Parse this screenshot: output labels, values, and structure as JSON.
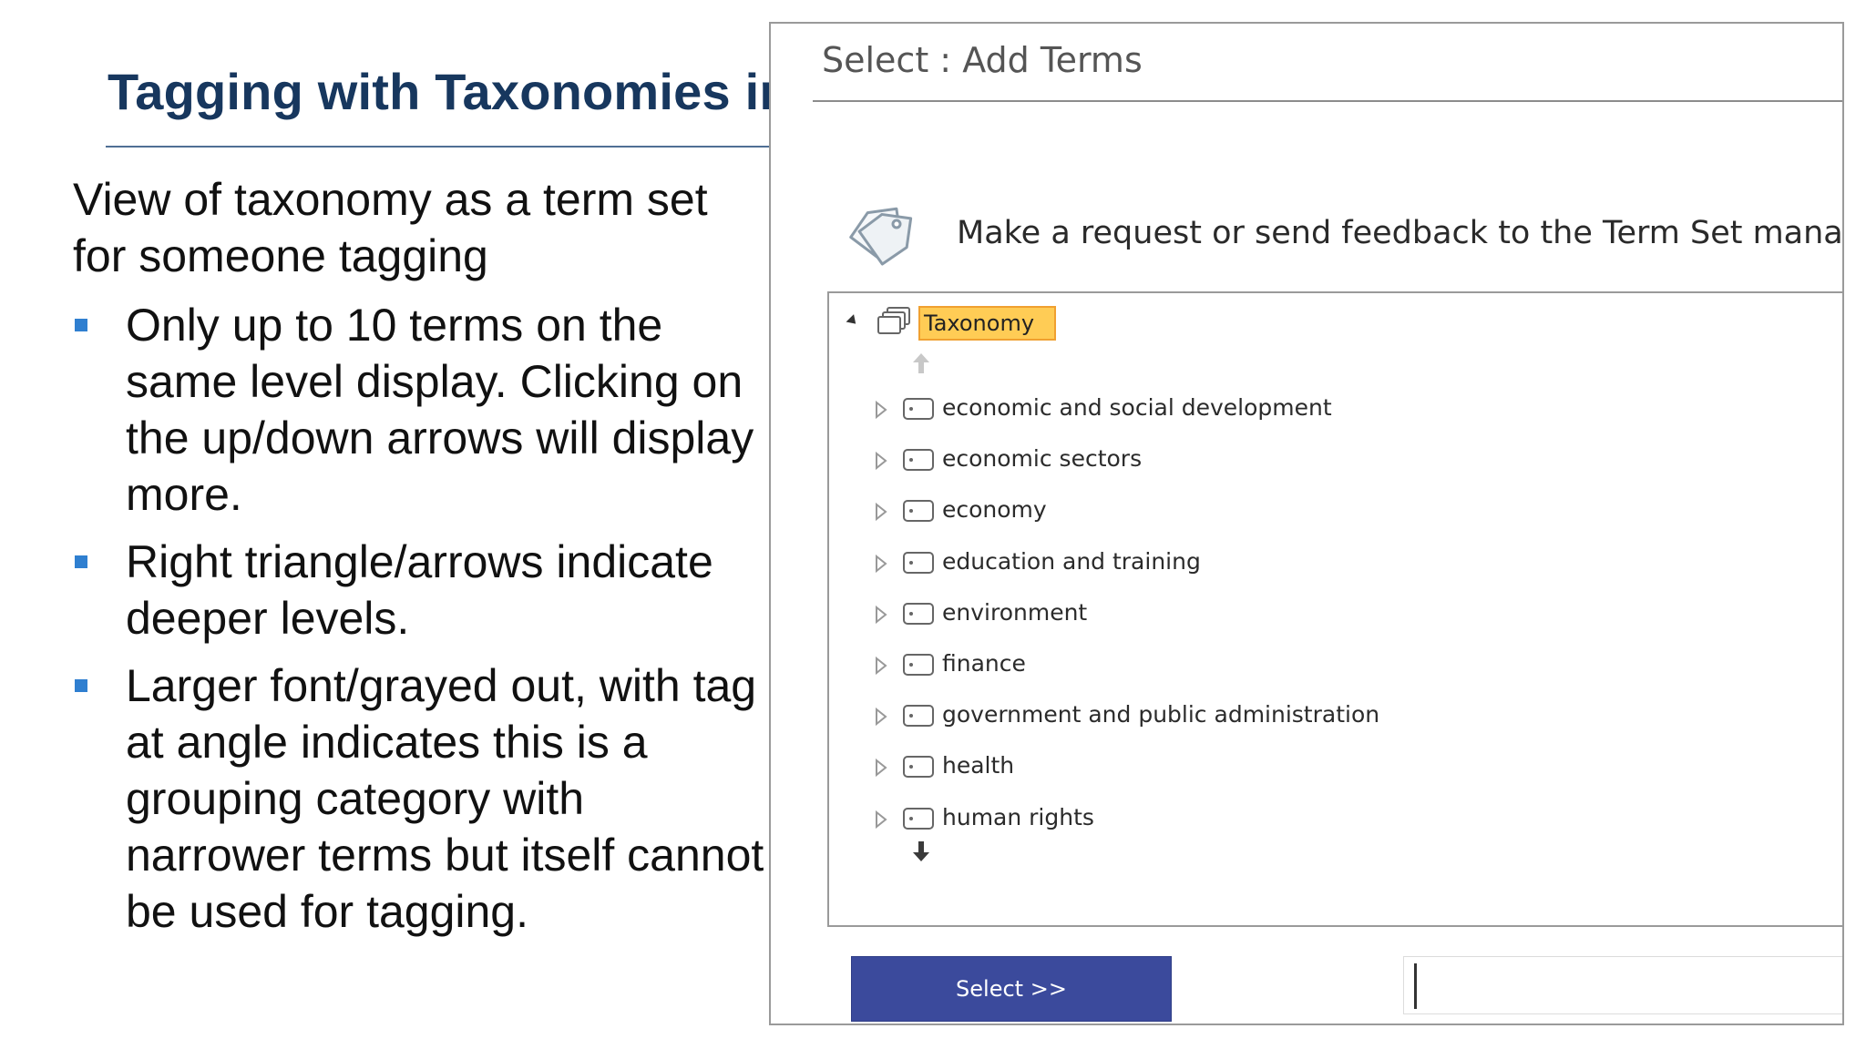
{
  "slide": {
    "title": "Tagging with Taxonomies in",
    "intro": "View of taxonomy as a term set for someone tagging",
    "bullets": [
      "Only up to 10 terms on the same level display. Clicking on the up/down arrows will display more.",
      "Right triangle/arrows indicate deeper levels.",
      "Larger font/grayed out, with tag at angle indicates this is a grouping category with narrower terms but itself cannot be used for tagging."
    ],
    "accent_color": "#2f7fd0",
    "title_color": "#17375e"
  },
  "dialog": {
    "title": "Select : Add Terms",
    "feedback": {
      "icon": "tag-icon",
      "label": "Make a request or send feedback to the Term Set manager."
    },
    "tree": {
      "root": {
        "label": "Taxonomy",
        "icon": "term-set-icon",
        "expanded": true,
        "highlight_color": "#ffcc55"
      },
      "terms": [
        {
          "label": "economic and social development"
        },
        {
          "label": "economic sectors"
        },
        {
          "label": "economy"
        },
        {
          "label": "education and training"
        },
        {
          "label": "environment"
        },
        {
          "label": "finance"
        },
        {
          "label": "government and public administration"
        },
        {
          "label": "health"
        },
        {
          "label": "human rights"
        }
      ]
    },
    "select_button": {
      "label": "Select >>",
      "color": "#3b4a9c"
    },
    "input": {
      "value": "",
      "placeholder": ""
    }
  }
}
